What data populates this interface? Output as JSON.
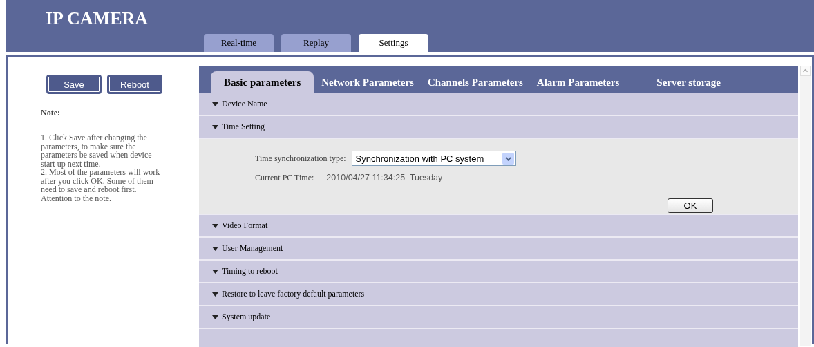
{
  "header": {
    "title": "IP CAMERA"
  },
  "main_tabs": [
    {
      "label": "Real-time",
      "selected": false
    },
    {
      "label": "Replay",
      "selected": false
    },
    {
      "label": "Settings",
      "selected": true
    }
  ],
  "sidebar": {
    "buttons": [
      "Save",
      "Reboot"
    ],
    "note_title": "Note:",
    "note_lines": [
      "1. Click Save after changing the parameters, to make sure the parameters be saved when device start up next time.",
      "2. Most of the parameters will work after you click OK. Some of them need to save and reboot first. Attention to the note."
    ]
  },
  "settings_tabs": [
    {
      "label": "Basic parameters",
      "selected": true
    },
    {
      "label": "Network Parameters",
      "selected": false
    },
    {
      "label": "Channels Parameters",
      "selected": false
    },
    {
      "label": "Alarm Parameters",
      "selected": false
    },
    {
      "label": "Server storage",
      "selected": false
    }
  ],
  "sections": [
    {
      "title": "Device Name",
      "expanded": false
    },
    {
      "title": "Time Setting",
      "expanded": true,
      "sync_label": "Time synchronization type:",
      "sync_value": "Synchronization with PC system",
      "time_label": "Current PC Time:",
      "time_value": "2010/04/27 11:34:25  Tuesday",
      "ok_button": "OK"
    },
    {
      "title": "Video Format",
      "expanded": false
    },
    {
      "title": "User Management",
      "expanded": false
    },
    {
      "title": "Timing to reboot",
      "expanded": false
    },
    {
      "title": "Restore to leave factory default parameters",
      "expanded": false
    },
    {
      "title": "System update",
      "expanded": false
    }
  ]
}
